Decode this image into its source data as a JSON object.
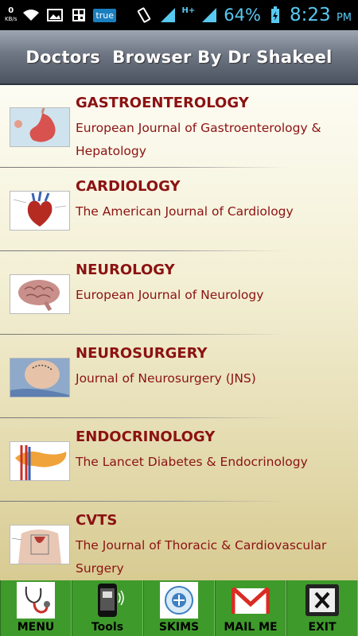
{
  "status_bar": {
    "speed_value": "0",
    "speed_unit": "KB/s",
    "carrier_badge": "true",
    "network": "H+",
    "battery_percent": "64%",
    "time": "8:23",
    "ampm": "PM"
  },
  "header": {
    "title": "Doctors  Browser By Dr Shakeel"
  },
  "list": {
    "items": [
      {
        "title": "GASTROENTEROLOGY",
        "subtitle": "European Journal of Gastroenterology & Hepatology",
        "icon": "stomach-icon"
      },
      {
        "title": "CARDIOLOGY",
        "subtitle": "The American Journal of Cardiology",
        "icon": "heart-icon"
      },
      {
        "title": "NEUROLOGY",
        "subtitle": "European Journal of Neurology",
        "icon": "brain-icon"
      },
      {
        "title": "NEUROSURGERY",
        "subtitle": "Journal of Neurosurgery (JNS)",
        "icon": "head-surgery-icon"
      },
      {
        "title": "ENDOCRINOLOGY",
        "subtitle": "The Lancet Diabetes & Endocrinology",
        "icon": "pancreas-icon"
      },
      {
        "title": "CVTS",
        "subtitle": "The Journal of Thoracic & Cardiovascular Surgery",
        "icon": "thorax-icon"
      }
    ]
  },
  "tabbar": {
    "tabs": [
      {
        "label": "MENU",
        "icon": "stethoscope-icon"
      },
      {
        "label": "Tools",
        "icon": "phone-tools-icon"
      },
      {
        "label": "SKIMS",
        "icon": "skims-logo-icon"
      },
      {
        "label": "MAIL ME",
        "icon": "mail-icon"
      },
      {
        "label": "EXIT",
        "icon": "exit-icon"
      }
    ]
  },
  "colors": {
    "title_text": "#8b1212",
    "tabbar_bg": "#3f9a2c",
    "status_accent": "#58c9f0"
  }
}
